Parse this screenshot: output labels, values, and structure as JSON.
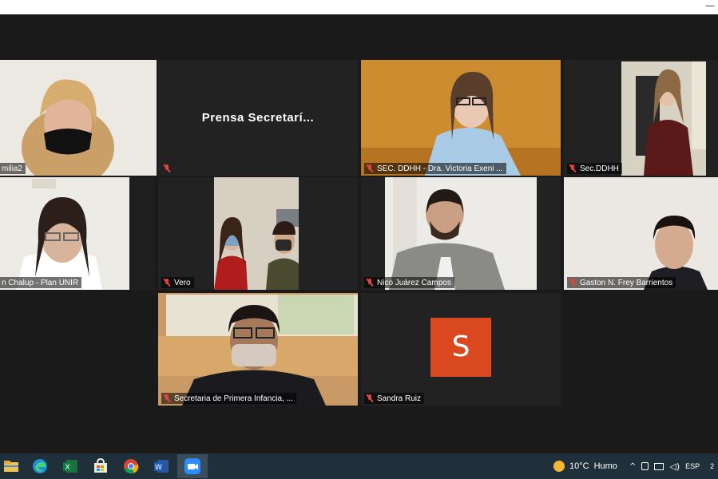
{
  "window": {
    "minimize_glyph": "—"
  },
  "participants": [
    {
      "name": "milia2",
      "muted": true,
      "active_speaker": true
    },
    {
      "name": "Prensa Secretarí...",
      "muted": true,
      "video": false,
      "display_name": "Prensa Secretarí..."
    },
    {
      "name": "SEC. DDHH - Dra. Victoria Exeni ...",
      "muted": true
    },
    {
      "name": "Sec.DDHH",
      "muted": true
    },
    {
      "name": "n Chalup - Plan UNIR",
      "muted": false
    },
    {
      "name": "Vero",
      "muted": true
    },
    {
      "name": "Nico Juárez Campos",
      "muted": true
    },
    {
      "name": "Gaston N. Frey Barrientos",
      "muted": true
    },
    {
      "name": "Secretaria de Primera Infancia, ...",
      "muted": true
    },
    {
      "name": "Sandra Ruiz",
      "muted": true,
      "video": false,
      "avatar_letter": "S",
      "avatar_color": "#d9481f"
    }
  ],
  "taskbar": {
    "apps": [
      "file-explorer-icon",
      "edge-icon",
      "excel-icon",
      "store-icon",
      "chrome-icon",
      "word-icon",
      "zoom-icon"
    ],
    "weather_temp": "10°C",
    "weather_text": "Humo",
    "language": "ESP",
    "clock_partial": "2"
  },
  "colors": {
    "active_border": "#c8e05a",
    "mute_red": "#e0443c",
    "taskbar": "#20303b"
  }
}
